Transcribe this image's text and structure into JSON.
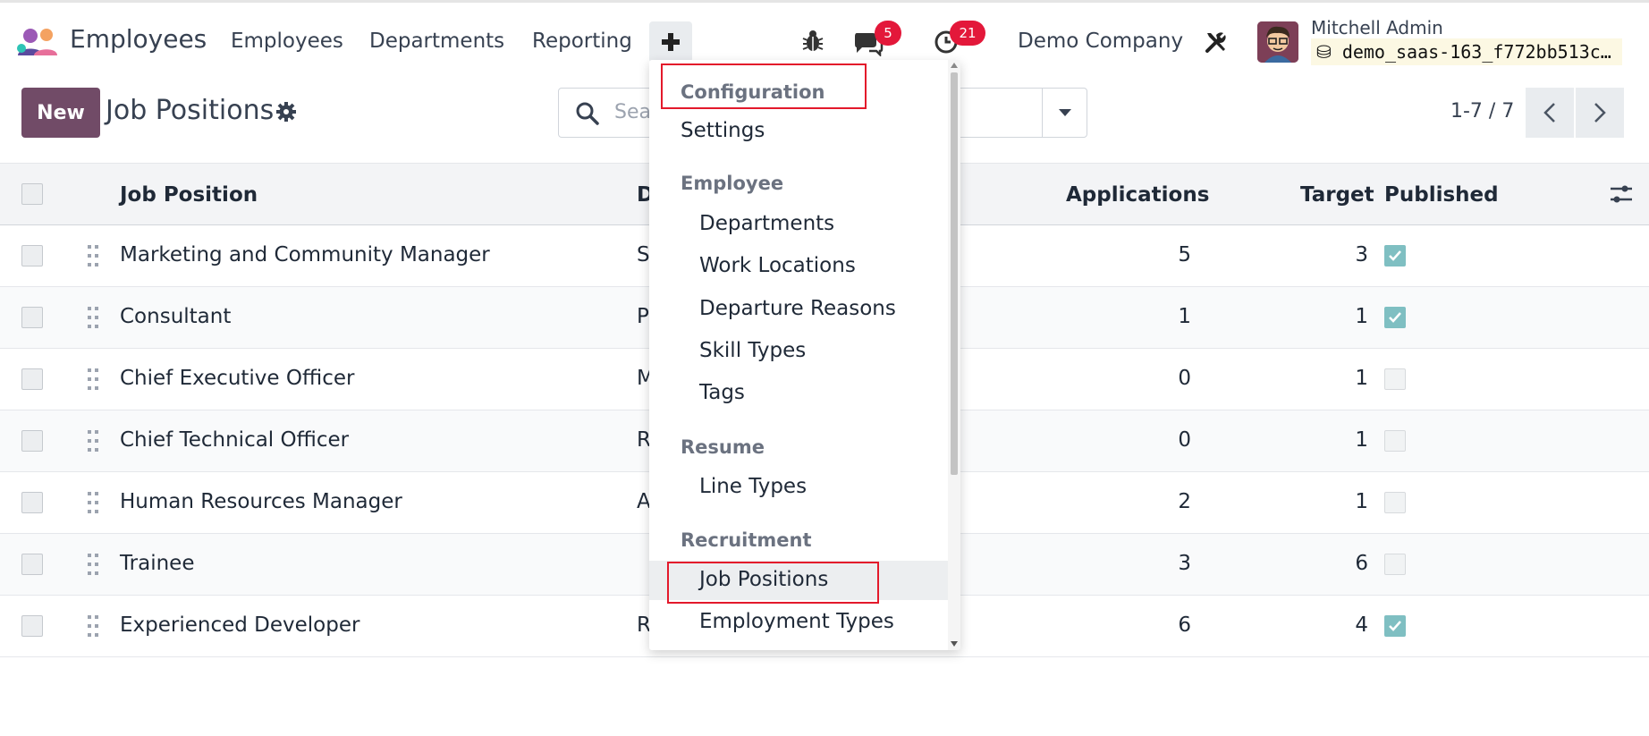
{
  "navbar": {
    "app_name": "Employees",
    "menus": [
      "Employees",
      "Departments",
      "Reporting"
    ],
    "plus_icon": "plus-icon",
    "messages_badge": "5",
    "activities_badge": "21",
    "company": "Demo Company",
    "user": {
      "name": "Mitchell Admin",
      "database": "demo_saas-163_f772bb513c..."
    }
  },
  "control_panel": {
    "new_label": "New",
    "title": "Job Positions",
    "search_placeholder": "Sea",
    "pager": "1-7 / 7"
  },
  "table": {
    "columns": {
      "job_position": "Job Position",
      "department": "D",
      "applications": "Applications",
      "target": "Target",
      "published": "Published"
    },
    "rows": [
      {
        "name": "Marketing and Community Manager",
        "department": "S",
        "applications": "5",
        "target": "3",
        "published": true
      },
      {
        "name": "Consultant",
        "department": "P",
        "applications": "1",
        "target": "1",
        "published": true
      },
      {
        "name": "Chief Executive Officer",
        "department": "M",
        "applications": "0",
        "target": "1",
        "published": false
      },
      {
        "name": "Chief Technical Officer",
        "department": "R",
        "applications": "0",
        "target": "1",
        "published": false
      },
      {
        "name": "Human Resources Manager",
        "department": "A",
        "applications": "2",
        "target": "1",
        "published": false
      },
      {
        "name": "Trainee",
        "department": "",
        "applications": "3",
        "target": "6",
        "published": false
      },
      {
        "name": "Experienced Developer",
        "department": "R",
        "applications": "6",
        "target": "4",
        "published": true
      }
    ]
  },
  "config_menu": {
    "sections": [
      {
        "header": "Configuration",
        "items": [
          "Settings"
        ]
      },
      {
        "header": "Employee",
        "items": [
          "Departments",
          "Work Locations",
          "Departure Reasons",
          "Skill Types",
          "Tags"
        ]
      },
      {
        "header": "Resume",
        "items": [
          "Line Types"
        ]
      },
      {
        "header": "Recruitment",
        "items": [
          "Job Positions",
          "Employment Types"
        ]
      }
    ],
    "active_item": "Job Positions"
  },
  "colors": {
    "brand": "#714b67",
    "badge": "#e3183a",
    "published_check": "#7fbfc2",
    "highlight_box": "#e3192b"
  }
}
